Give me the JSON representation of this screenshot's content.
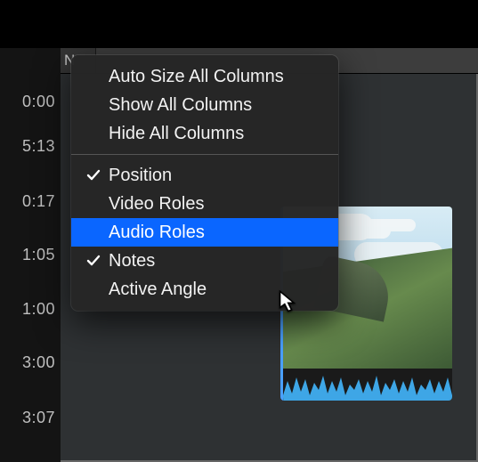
{
  "ruler_label": "N",
  "times": [
    "0:00",
    "5:13",
    "0:17",
    "1:05",
    "1:00",
    "3:00",
    "3:07"
  ],
  "menu": {
    "auto_size": "Auto Size All Columns",
    "show_all": "Show All Columns",
    "hide_all": "Hide All Columns",
    "position": "Position",
    "video_roles": "Video Roles",
    "audio_roles": "Audio Roles",
    "notes": "Notes",
    "active_angle": "Active Angle",
    "checked": {
      "position": true,
      "notes": true
    },
    "highlighted": "audio_roles"
  }
}
